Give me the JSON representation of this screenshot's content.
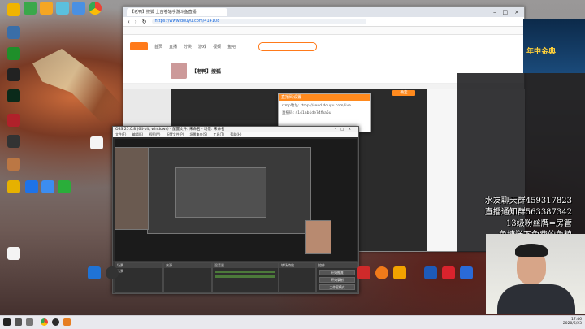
{
  "browser": {
    "tabs": [
      "【老鸭】搜狐 上古卷轴手游斗鱼直播"
    ],
    "url": "https://www.douyu.com/414108",
    "nav_items": [
      "首页",
      "直播",
      "分类",
      "游戏",
      "视频",
      "鱼吧"
    ],
    "streamer_name": "【老鸭】搜狐"
  },
  "dialog": {
    "title": "直播码设置",
    "rows": [
      "rtmp地址:  rtmp://send.douyu.com/live",
      "直播码:  4141ab1de74fba5u"
    ],
    "confirm": "确定"
  },
  "ad": {
    "text": "年中金典"
  },
  "overlay": {
    "lines": [
      "水友聊天群459317823",
      "直播通知群563387342",
      "13级粉丝牌=房管",
      "鱼塘送下免费的鱼粮"
    ]
  },
  "obs": {
    "title": "OBS 25.0.8 (64-bit, windows) - 配置文件: 未命名 - 场景: 未命名",
    "menu": "文件(F) 编辑(E) 视图(V) 配置文件(P) 场景集合(S) 工具(T) 帮助(H)",
    "docks": [
      "场景",
      "来源",
      "混音器",
      "转场特效",
      "控件"
    ],
    "scene_item": "场景",
    "controls": [
      "开始推流",
      "开始录制",
      "工作室模式",
      "设置",
      "退出"
    ]
  },
  "taskbar": {
    "time": "17:46",
    "date": "2020/6/23"
  }
}
